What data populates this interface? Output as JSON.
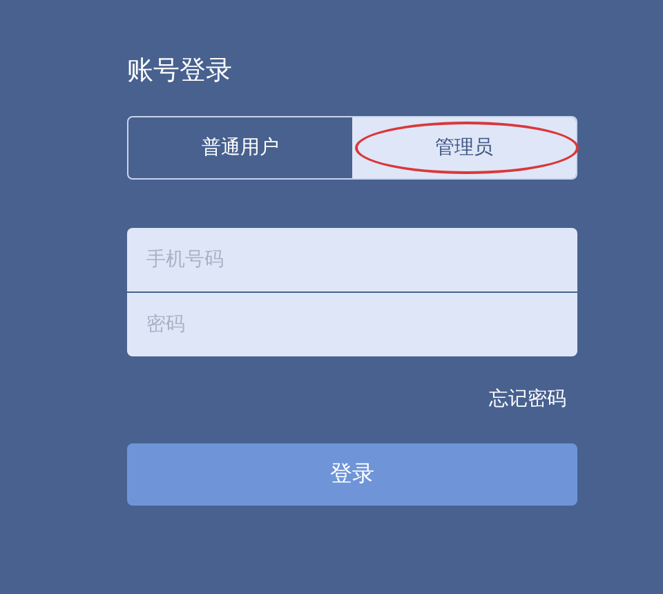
{
  "title": "账号登录",
  "tabs": [
    {
      "label": "普通用户",
      "selected": false,
      "circled": false
    },
    {
      "label": "管理员",
      "selected": true,
      "circled": true
    }
  ],
  "fields": [
    {
      "placeholder": "手机号码"
    },
    {
      "placeholder": "密码"
    }
  ],
  "forgot_link": "忘记密码",
  "login_button": "登录"
}
